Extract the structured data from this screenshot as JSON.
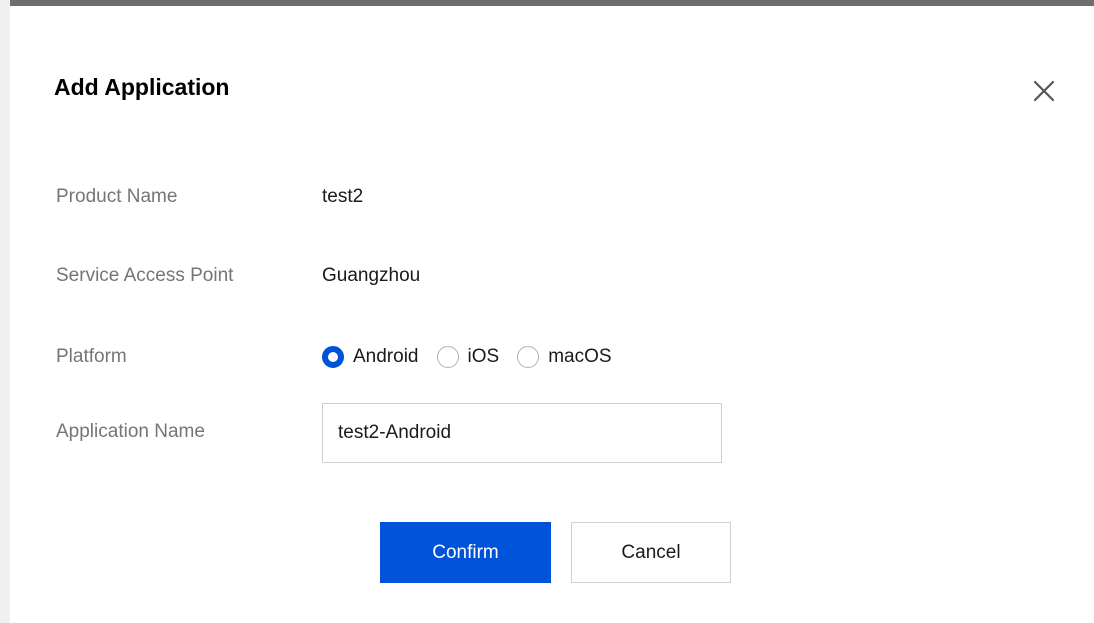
{
  "dialog": {
    "title": "Add Application",
    "close_icon": "close-icon"
  },
  "fields": {
    "product_name": {
      "label": "Product Name",
      "value": "test2"
    },
    "service_access_point": {
      "label": "Service Access Point",
      "value": "Guangzhou"
    },
    "platform": {
      "label": "Platform",
      "options": [
        "Android",
        "iOS",
        "macOS"
      ],
      "selected": "Android"
    },
    "application_name": {
      "label": "Application Name",
      "value": "test2-Android"
    }
  },
  "buttons": {
    "confirm": "Confirm",
    "cancel": "Cancel"
  },
  "colors": {
    "primary": "#0052d9",
    "label": "#757575",
    "text": "#1a1a1a"
  }
}
